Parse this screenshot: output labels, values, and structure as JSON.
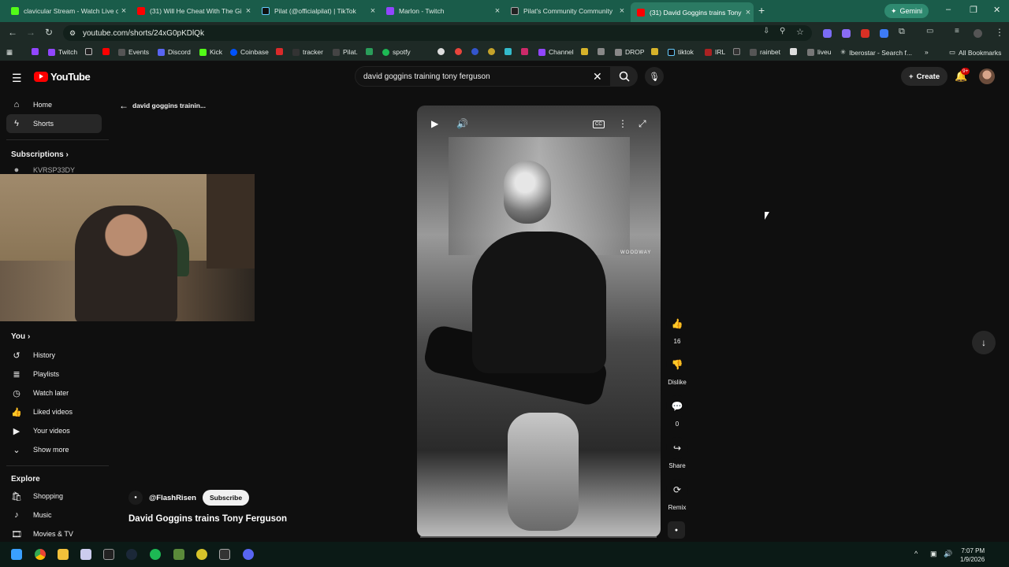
{
  "browser": {
    "tabs": [
      {
        "title": "clavicular Stream - Watch Live o",
        "color": "#53fc18"
      },
      {
        "title": "(31) Will He Cheat With The Gi",
        "color": "#ff0000"
      },
      {
        "title": "Pilat (@officialpilat) | TikTok",
        "color": "#111111"
      },
      {
        "title": "Marlon - Twitch",
        "color": "#9146ff"
      },
      {
        "title": "Pilat's Community Community",
        "color": "#222222"
      },
      {
        "title": "(31) David Goggins trains Tony",
        "color": "#ff0000"
      }
    ],
    "gemini_label": "Gemini",
    "url": "youtube.com/shorts/24xG0pKDlQk",
    "bookmarks": [
      {
        "label": "Twitch",
        "color": "#9146ff"
      },
      {
        "label": "Events",
        "color": "#555555"
      },
      {
        "label": "Discord",
        "color": "#5865f2"
      },
      {
        "label": "Kick",
        "color": "#53fc18"
      },
      {
        "label": "Coinbase",
        "color": "#0052ff"
      },
      {
        "label": "tracker",
        "color": "#cc3333"
      },
      {
        "label": "Pilat.",
        "color": "#444444"
      },
      {
        "label": "spotfy",
        "color": "#1db954"
      },
      {
        "label": "Channel",
        "color": "#9146ff"
      },
      {
        "label": "DROP",
        "color": "#888888"
      },
      {
        "label": "tiktok",
        "color": "#111111"
      },
      {
        "label": "IRL",
        "color": "#aa2222"
      },
      {
        "label": "rainbet",
        "color": "#555555"
      },
      {
        "label": "liveu",
        "color": "#777777"
      },
      {
        "label": "Iberostar - Search f...",
        "color": "#888888"
      }
    ],
    "all_bookmarks": "All Bookmarks"
  },
  "youtube": {
    "logo": "YouTube",
    "search_query": "david goggins training tony ferguson",
    "create_label": "Create",
    "notif_badge": "9+",
    "sidebar": {
      "home": "Home",
      "shorts": "Shorts",
      "subscriptions": "Subscriptions",
      "sub_channel": "KVRSP33DY",
      "you": "You",
      "you_items": [
        "History",
        "Playlists",
        "Watch later",
        "Liked videos",
        "Your videos",
        "Show more"
      ],
      "explore": "Explore",
      "explore_items": [
        "Shopping",
        "Music",
        "Movies & TV"
      ]
    },
    "short": {
      "breadcrumb_title": "david goggins trainin...",
      "channel": "@FlashRisen",
      "subscribe": "Subscribe",
      "title": "David Goggins trains Tony Ferguson",
      "brand_on_video": "WOODWAY",
      "likes": "16",
      "dislike": "Dislike",
      "comments": "0",
      "share": "Share",
      "remix": "Remix"
    }
  },
  "taskbar": {
    "time": "7:07 PM",
    "date": "1/9/2026"
  }
}
